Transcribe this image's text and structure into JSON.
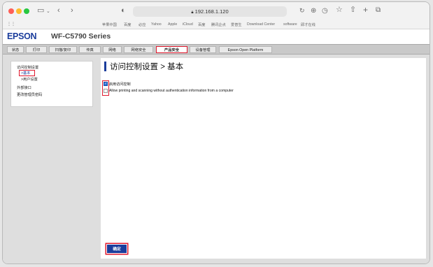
{
  "browser": {
    "url": "192.168.1.120",
    "favorites": [
      "苹果中国",
      "百度",
      "必应",
      "Yahoo",
      "Apple",
      "iCloud",
      "百度",
      "腾讯企点",
      "爱普生",
      "Download Center",
      "software",
      "即才在线"
    ]
  },
  "header": {
    "brand": "EPSON",
    "model": "WF-C5790 Series"
  },
  "tabs": [
    {
      "label": "状态"
    },
    {
      "label": "打印"
    },
    {
      "label": "扫描/复印"
    },
    {
      "label": "传真"
    },
    {
      "label": "网络"
    },
    {
      "label": "网络安全"
    },
    {
      "label": "产品安全",
      "active": true
    },
    {
      "label": "设备管理"
    },
    {
      "label": "Epson Open Platform"
    }
  ],
  "sidebar": {
    "items": [
      {
        "label": "访问控制设置"
      },
      {
        "label": ">基本"
      },
      {
        "label": ">用户设置"
      },
      {
        "label": "外部接口"
      },
      {
        "label": "更改管理员密码"
      }
    ]
  },
  "main": {
    "title": "访问控制设置 > 基本",
    "options": [
      {
        "label": "启用访问控制",
        "checked": true
      },
      {
        "label": "Allow printing and scanning without authentication information from a computer",
        "checked": false
      }
    ],
    "ok_label": "确定"
  },
  "colors": {
    "brand_blue": "#1b3d9c",
    "highlight_red": "#e0192e"
  }
}
